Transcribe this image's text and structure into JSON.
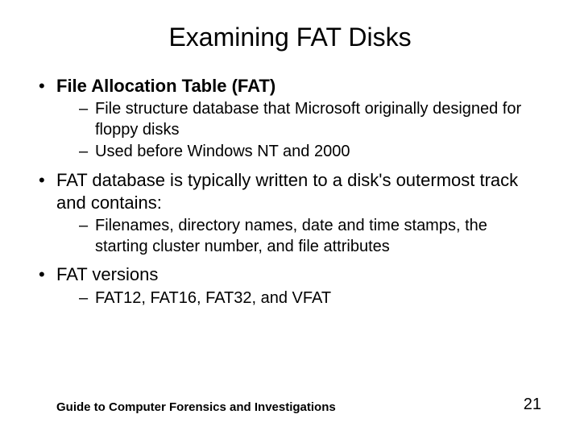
{
  "title": "Examining FAT Disks",
  "bullets": [
    {
      "label": "File Allocation Table (FAT)",
      "bold": true,
      "sub": [
        "File structure database that Microsoft originally designed for floppy disks",
        "Used before Windows NT and 2000"
      ]
    },
    {
      "label": "FAT database is typically written to a disk's outermost track and contains:",
      "bold": false,
      "sub": [
        "Filenames, directory names, date and time stamps, the starting cluster number, and file attributes"
      ]
    },
    {
      "label": "FAT versions",
      "bold": false,
      "sub": [
        "FAT12, FAT16, FAT32, and VFAT"
      ]
    }
  ],
  "footer": {
    "left": "Guide to Computer Forensics and Investigations",
    "right": "21"
  }
}
